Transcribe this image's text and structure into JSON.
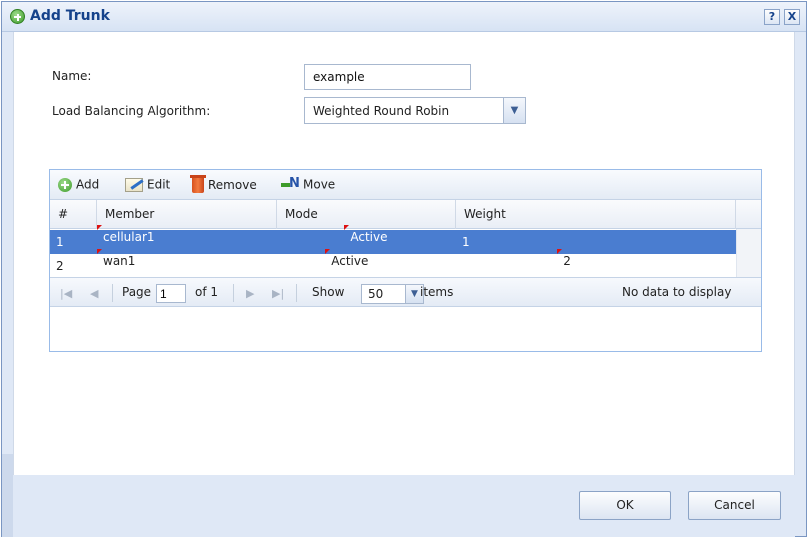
{
  "dialog": {
    "title": "Add Trunk",
    "help_glyph": "?",
    "close_glyph": "X"
  },
  "form": {
    "name_label": "Name:",
    "name_value": "example",
    "lb_label": "Load Balancing Algorithm:",
    "lb_value": "Weighted Round Robin"
  },
  "toolbar": {
    "add": "Add",
    "edit": "Edit",
    "remove": "Remove",
    "move": "Move"
  },
  "table": {
    "headers": [
      "#",
      "Member",
      "Mode",
      "Weight"
    ],
    "rows": [
      {
        "num": "1",
        "member": "cellular1",
        "mode": "Active",
        "weight": "1",
        "selected": true
      },
      {
        "num": "2",
        "member": "wan1",
        "mode": "Active",
        "weight": "2",
        "selected": false
      }
    ]
  },
  "pager": {
    "page_label": "Page",
    "page_value": "1",
    "of_label": "of 1",
    "show_label": "Show",
    "show_value": "50",
    "items_label": "items",
    "status": "No data to display"
  },
  "buttons": {
    "ok": "OK",
    "cancel": "Cancel"
  },
  "colors": {
    "title": "#15428b",
    "selected_row": "#4a7dd0",
    "dirty_marker": "#dd1111"
  }
}
